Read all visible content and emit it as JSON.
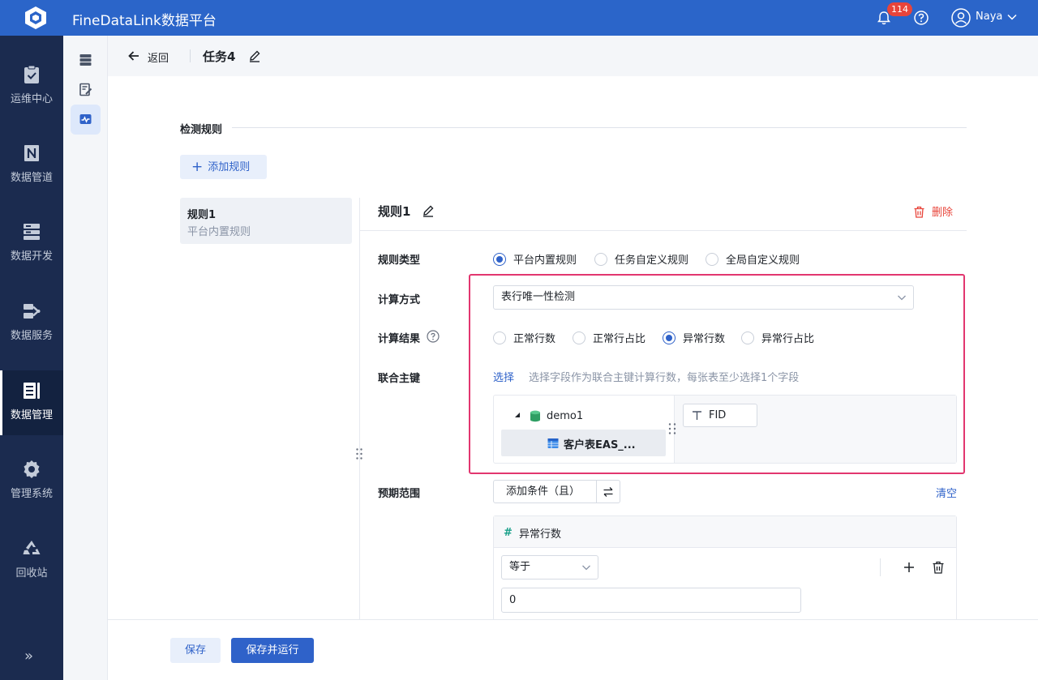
{
  "app": {
    "title": "FineDataLink数据平台"
  },
  "topbar": {
    "notification_count": "114",
    "user_name": "Naya"
  },
  "leftnav": {
    "items": [
      {
        "label": "运维中心",
        "icon": "clipboard-check-icon"
      },
      {
        "label": "数据管道",
        "icon": "pipeline-icon"
      },
      {
        "label": "数据开发",
        "icon": "server-stack-icon"
      },
      {
        "label": "数据服务",
        "icon": "service-icon"
      },
      {
        "label": "数据管理",
        "icon": "book-catalog-icon",
        "active": true
      },
      {
        "label": "管理系统",
        "icon": "gear-icon"
      },
      {
        "label": "回收站",
        "icon": "recycle-icon"
      }
    ],
    "expand_glyph": "»"
  },
  "header": {
    "back_label": "返回",
    "task_name": "任务4"
  },
  "section": {
    "title": "检测规则",
    "add_rule_label": "添加规则"
  },
  "rule_list": [
    {
      "title": "规则1",
      "subtitle": "平台内置规则"
    }
  ],
  "rule": {
    "title": "规则1",
    "delete_label": "删除",
    "type": {
      "label": "规则类型",
      "options": [
        "平台内置规则",
        "任务自定义规则",
        "全局自定义规则"
      ],
      "selected": "平台内置规则"
    },
    "calc_method": {
      "label": "计算方式",
      "value": "表行唯一性检测"
    },
    "calc_result": {
      "label": "计算结果",
      "options": [
        "正常行数",
        "正常行占比",
        "异常行数",
        "异常行占比"
      ],
      "selected": "异常行数"
    },
    "union_key": {
      "label": "联合主键",
      "choose_label": "选择",
      "hint": "选择字段作为联合主键计算行数，每张表至少选择1个字段",
      "database": "demo1",
      "table": "客户表EAS_...",
      "fields": [
        "FID"
      ]
    },
    "expected_range": {
      "label": "预期范围",
      "add_condition_label": "添加条件（且）",
      "clear_label": "清空",
      "condition_field": "异常行数",
      "operator": "等于",
      "value": "0"
    }
  },
  "footer": {
    "save_label": "保存",
    "save_run_label": "保存并运行"
  },
  "colors": {
    "topbar": "#2b65c9",
    "nav": "#1b2b4f",
    "accent": "#2f62c9",
    "danger": "#e8443a",
    "highlight": "#e2366f"
  }
}
